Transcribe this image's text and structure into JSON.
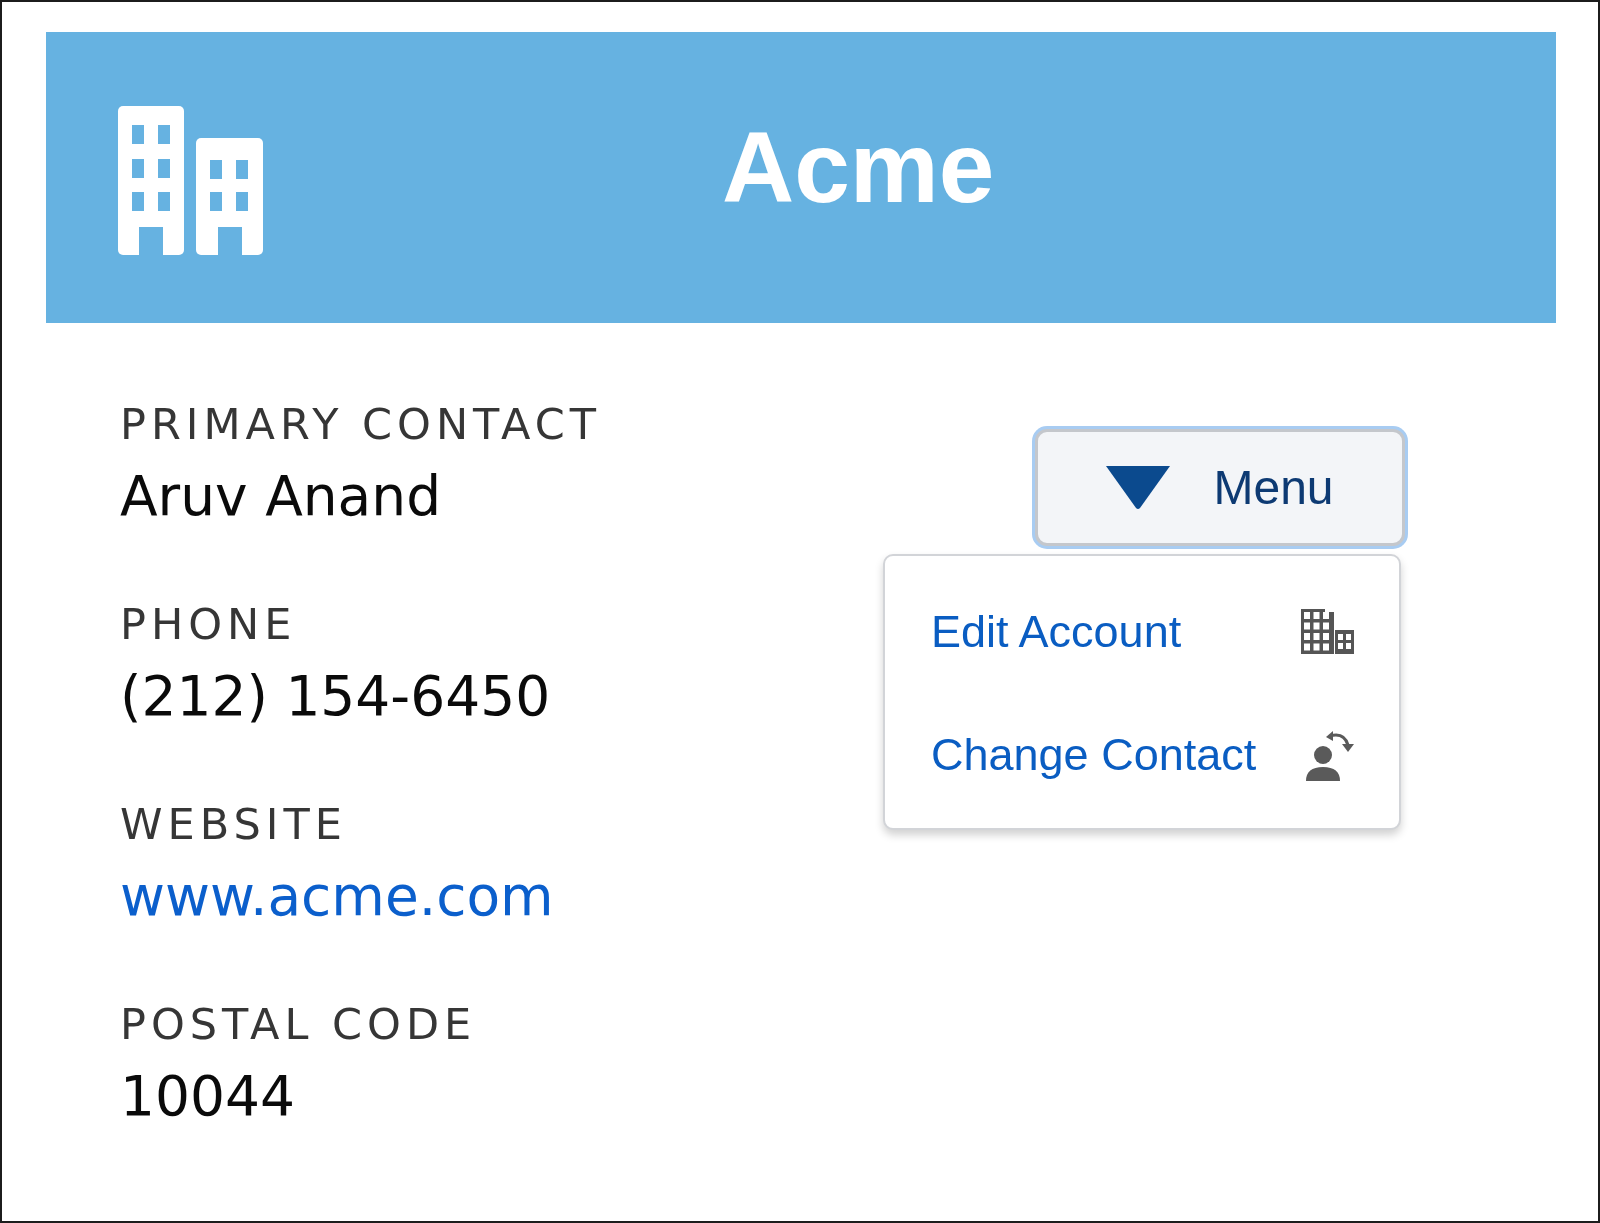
{
  "header": {
    "title": "Acme"
  },
  "fields": [
    {
      "label": "PRIMARY CONTACT",
      "value": "Aruv Anand",
      "kind": "text"
    },
    {
      "label": "PHONE",
      "value": "(212) 154-6450",
      "kind": "text"
    },
    {
      "label": "WEBSITE",
      "value": "www.acme.com",
      "kind": "link"
    },
    {
      "label": "POSTAL CODE",
      "value": "10044",
      "kind": "text"
    }
  ],
  "menu_button": {
    "label": "Menu",
    "focused": true,
    "expanded": true
  },
  "menu": {
    "items": [
      {
        "label": "Edit Account"
      },
      {
        "label": "Change Contact"
      }
    ]
  }
}
